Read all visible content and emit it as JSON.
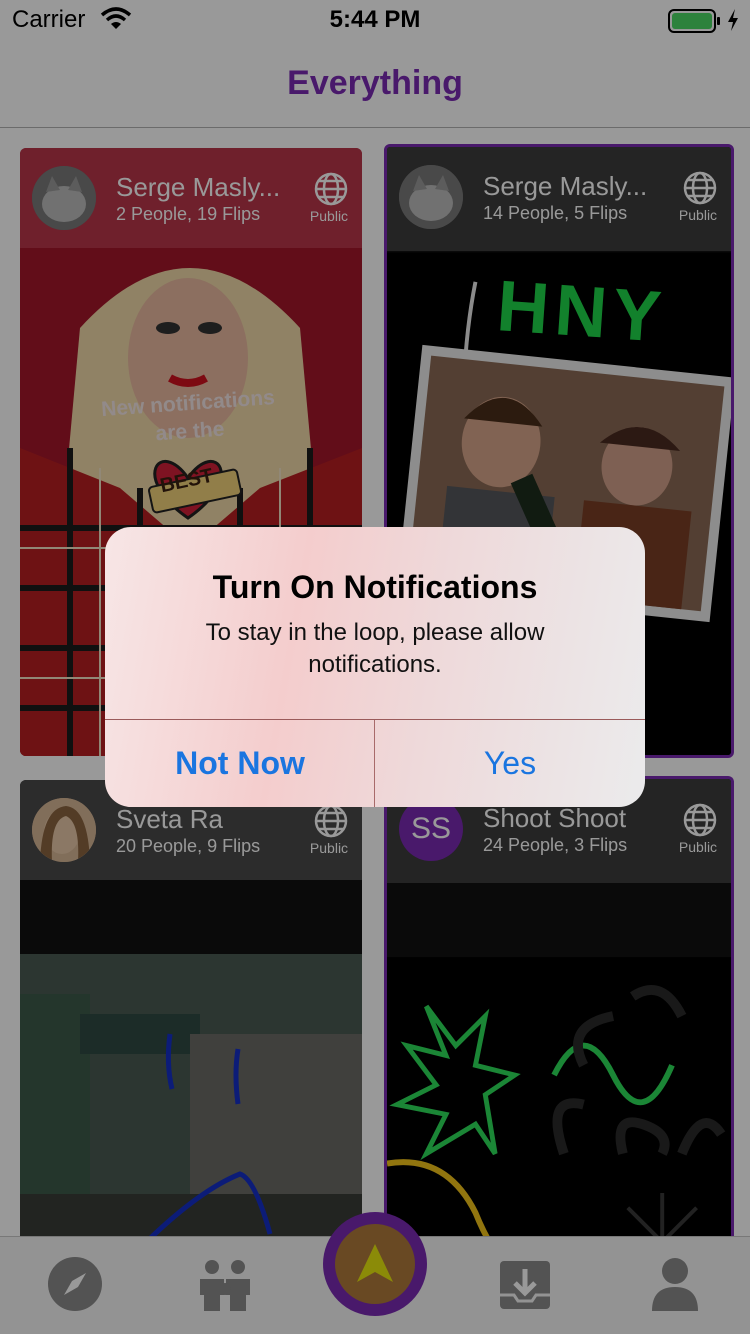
{
  "status_bar": {
    "carrier": "Carrier",
    "time": "5:44 PM"
  },
  "nav": {
    "title": "Everything"
  },
  "cards": [
    {
      "name": "Serge Masly...",
      "meta": "2 People, 19 Flips",
      "visibility": "Public",
      "image_text": "New notifications are the",
      "badge_text": "BEST"
    },
    {
      "name": "Serge Masly...",
      "meta": "14 People, 5 Flips",
      "visibility": "Public",
      "image_text": "HNY"
    },
    {
      "name": "Sveta Ra",
      "meta": "20 People, 9 Flips",
      "visibility": "Public"
    },
    {
      "name": "Shoot Shoot",
      "meta": "24 People, 3 Flips",
      "visibility": "Public",
      "initials": "SS"
    }
  ],
  "tabs": [
    "compass-icon",
    "people-icon",
    "create-icon",
    "inbox-icon",
    "profile-icon"
  ],
  "alert": {
    "title": "Turn On Notifications",
    "message": "To stay in the loop, please allow notifications.",
    "cancel_label": "Not Now",
    "confirm_label": "Yes"
  },
  "colors": {
    "accent": "#7b2ab3",
    "link": "#1a75e0"
  }
}
